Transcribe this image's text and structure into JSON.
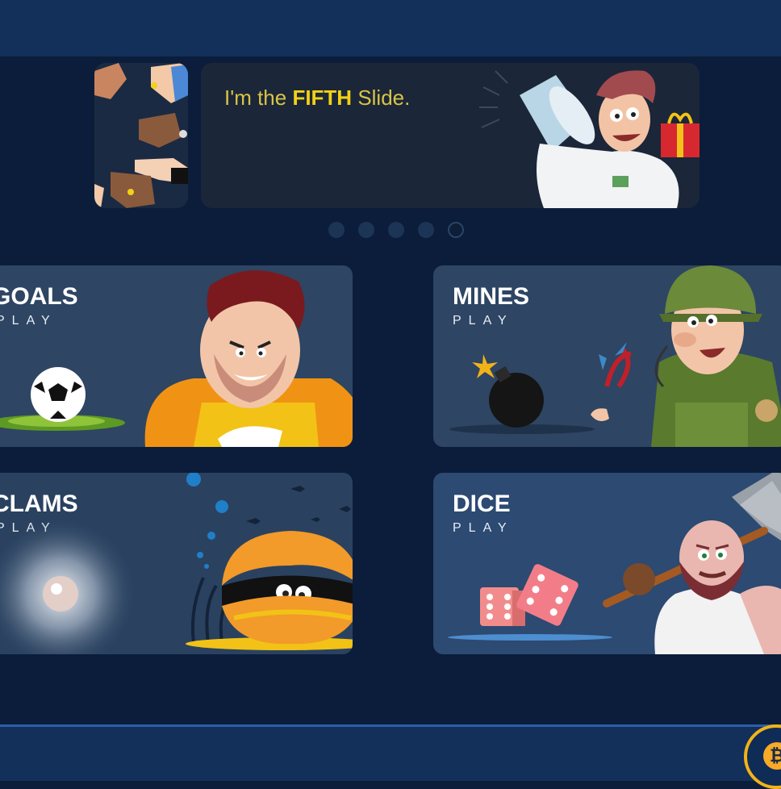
{
  "carousel": {
    "slide_prefix": "I'm the ",
    "slide_emphasis": "FIFTH",
    "slide_suffix": " Slide.",
    "dots_count": 5,
    "active_dot_index": 5
  },
  "games": [
    {
      "title": "GOALS",
      "play_label": "PLAY"
    },
    {
      "title": "MINES",
      "play_label": "PLAY"
    },
    {
      "title": "CLAMS",
      "play_label": "PLAY"
    },
    {
      "title": "DICE",
      "play_label": "PLAY"
    }
  ],
  "colors": {
    "page_bg": "#0b1d3a",
    "bar_bg": "#12305a",
    "card_goals_bg": "#2e4563",
    "card_mines_bg": "#2e4563",
    "card_clams_bg": "#2a4260",
    "card_dice_bg": "#2c4a72",
    "slide_text": "#f2d116"
  },
  "footer": {
    "currency_icon": "bitcoin-icon",
    "currency_symbol": "₿"
  }
}
